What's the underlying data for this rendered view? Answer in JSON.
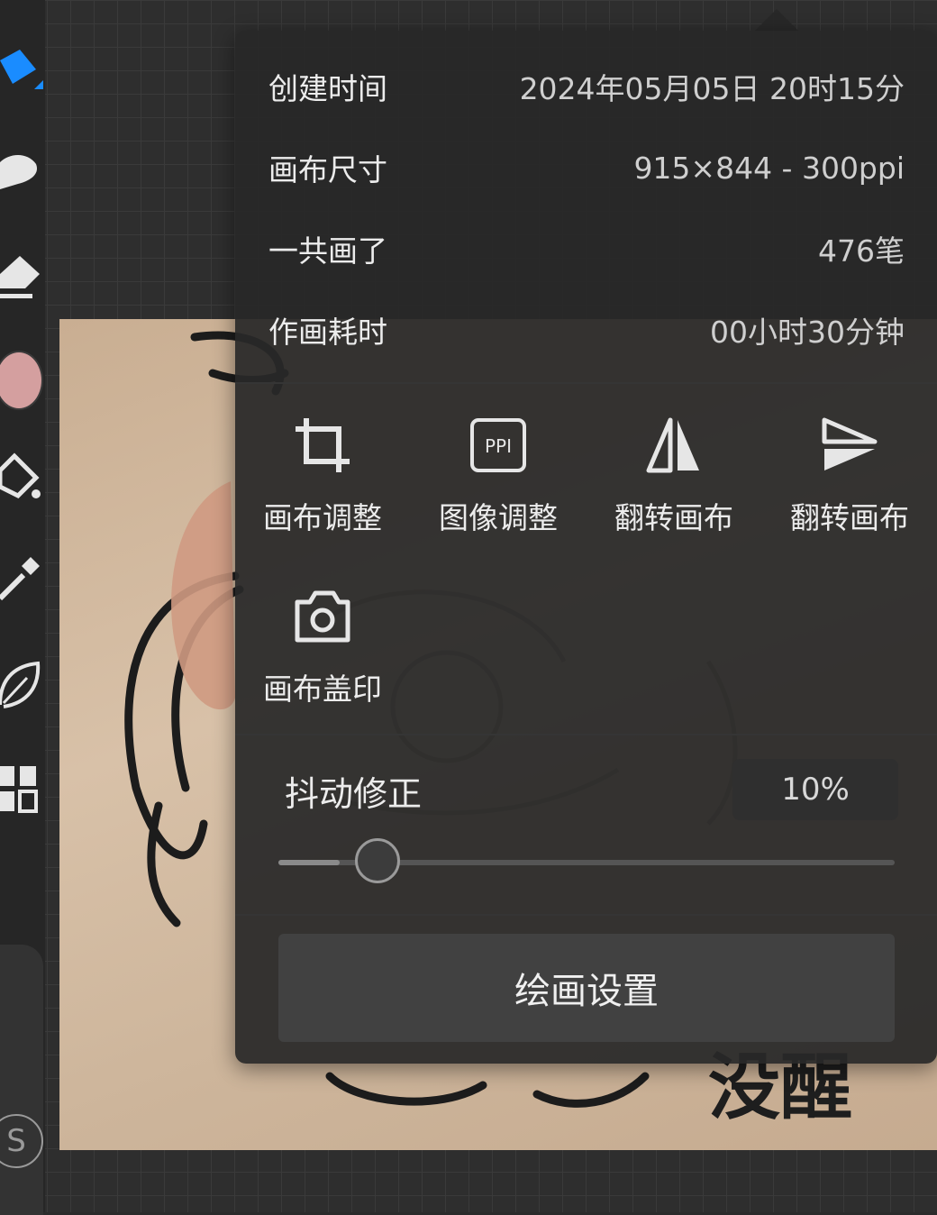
{
  "canvas_info": {
    "rows": [
      {
        "label": "创建时间",
        "value": "2024年05月05日 20时15分"
      },
      {
        "label": "画布尺寸",
        "value": "915×844 - 300ppi"
      },
      {
        "label": "一共画了",
        "value": "476笔"
      },
      {
        "label": "作画耗时",
        "value": "00小时30分钟"
      }
    ]
  },
  "actions": [
    {
      "label": "画布调整",
      "icon": "crop-icon"
    },
    {
      "label": "图像调整",
      "icon": "ppi-icon",
      "icon_text": "PPI"
    },
    {
      "label": "翻转画布",
      "icon": "flip-horizontal-icon"
    },
    {
      "label": "翻转画布",
      "icon": "flip-vertical-icon"
    },
    {
      "label": "画布盖印",
      "icon": "camera-icon"
    }
  ],
  "stabilizer": {
    "label": "抖动修正",
    "value_text": "10%",
    "value_fraction": 0.1
  },
  "settings_button": "绘画设置",
  "toolbar": {
    "tools": [
      "brush-icon",
      "smudge-icon",
      "eraser-icon",
      "color-swatch",
      "fill-bucket-icon",
      "eyedropper-icon",
      "leaf-icon",
      "layers-icon"
    ],
    "active_color": "#d49f9f",
    "accent_color": "#1a8cff",
    "badge_text": "S"
  },
  "artwork": {
    "signature_text": "没醒"
  }
}
